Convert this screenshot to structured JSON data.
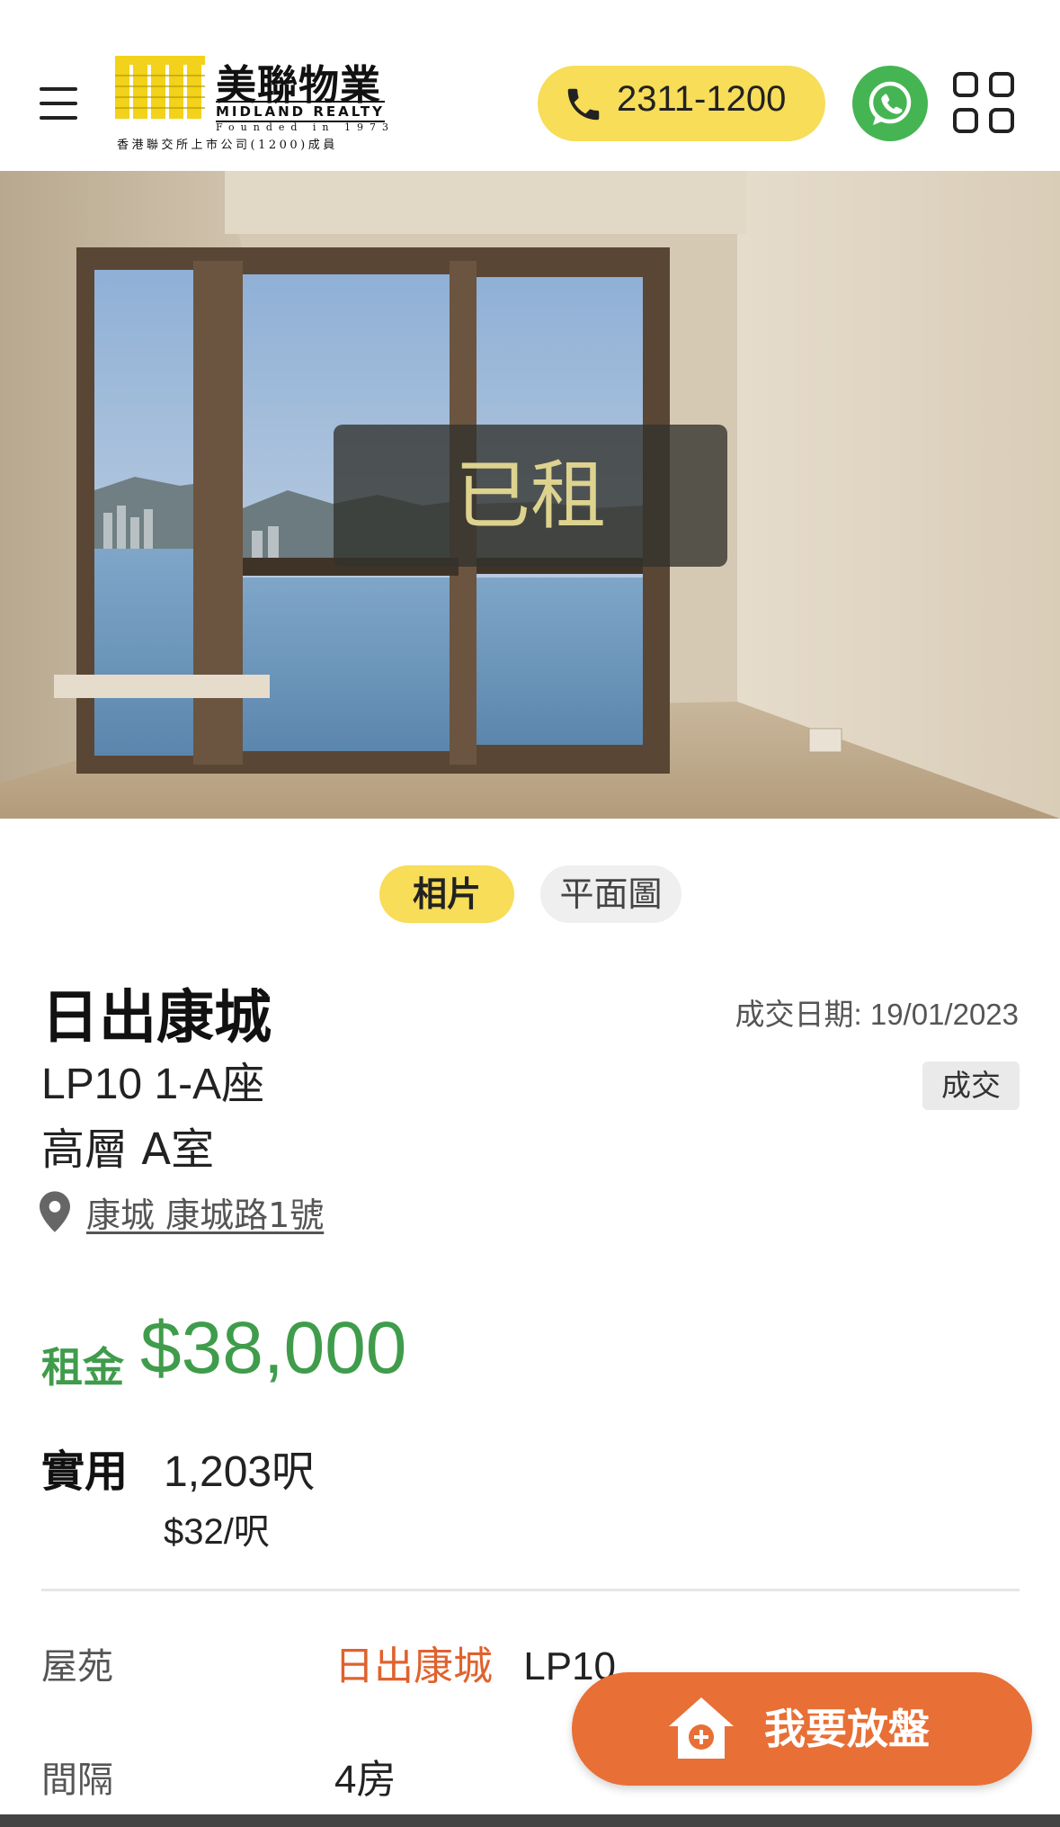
{
  "header": {
    "menu_icon": "hamburger-menu-icon",
    "logo": {
      "chinese_name": "美聯物業",
      "english_name": "MIDLAND REALTY",
      "founded": "Founded in 1973",
      "listed_note": "香港聯交所上市公司(1200)成員"
    },
    "phone": "2311-1200",
    "whatsapp_icon": "whatsapp-icon",
    "apps_icon": "grid-apps-icon",
    "brand_yellow": "#f7dd58",
    "whatsapp_green": "#45b553"
  },
  "photo": {
    "status_text": "已租"
  },
  "tabs": [
    {
      "label": "相片",
      "active": true
    },
    {
      "label": "平面圖",
      "active": false
    }
  ],
  "property": {
    "estate_name": "日出康城",
    "block": "LP10 1-A座",
    "floor_unit": "高層 A室",
    "deal_date_label": "成交日期: 19/01/2023",
    "deal_badge": "成交",
    "address": "康城 康城路1號",
    "rent_label": "租金",
    "rent_value": "$38,000",
    "area_label": "實用",
    "area_value": "1,203呎",
    "unit_price": "$32/呎",
    "rent_color": "#3f9c4b"
  },
  "info_rows": [
    {
      "label": "屋苑",
      "estate_link": "日出康城",
      "value": "LP10"
    },
    {
      "label": "間隔",
      "value": "4房"
    }
  ],
  "floating_button": {
    "label": "我要放盤",
    "icon": "home-add-icon",
    "color": "#e86f35"
  }
}
